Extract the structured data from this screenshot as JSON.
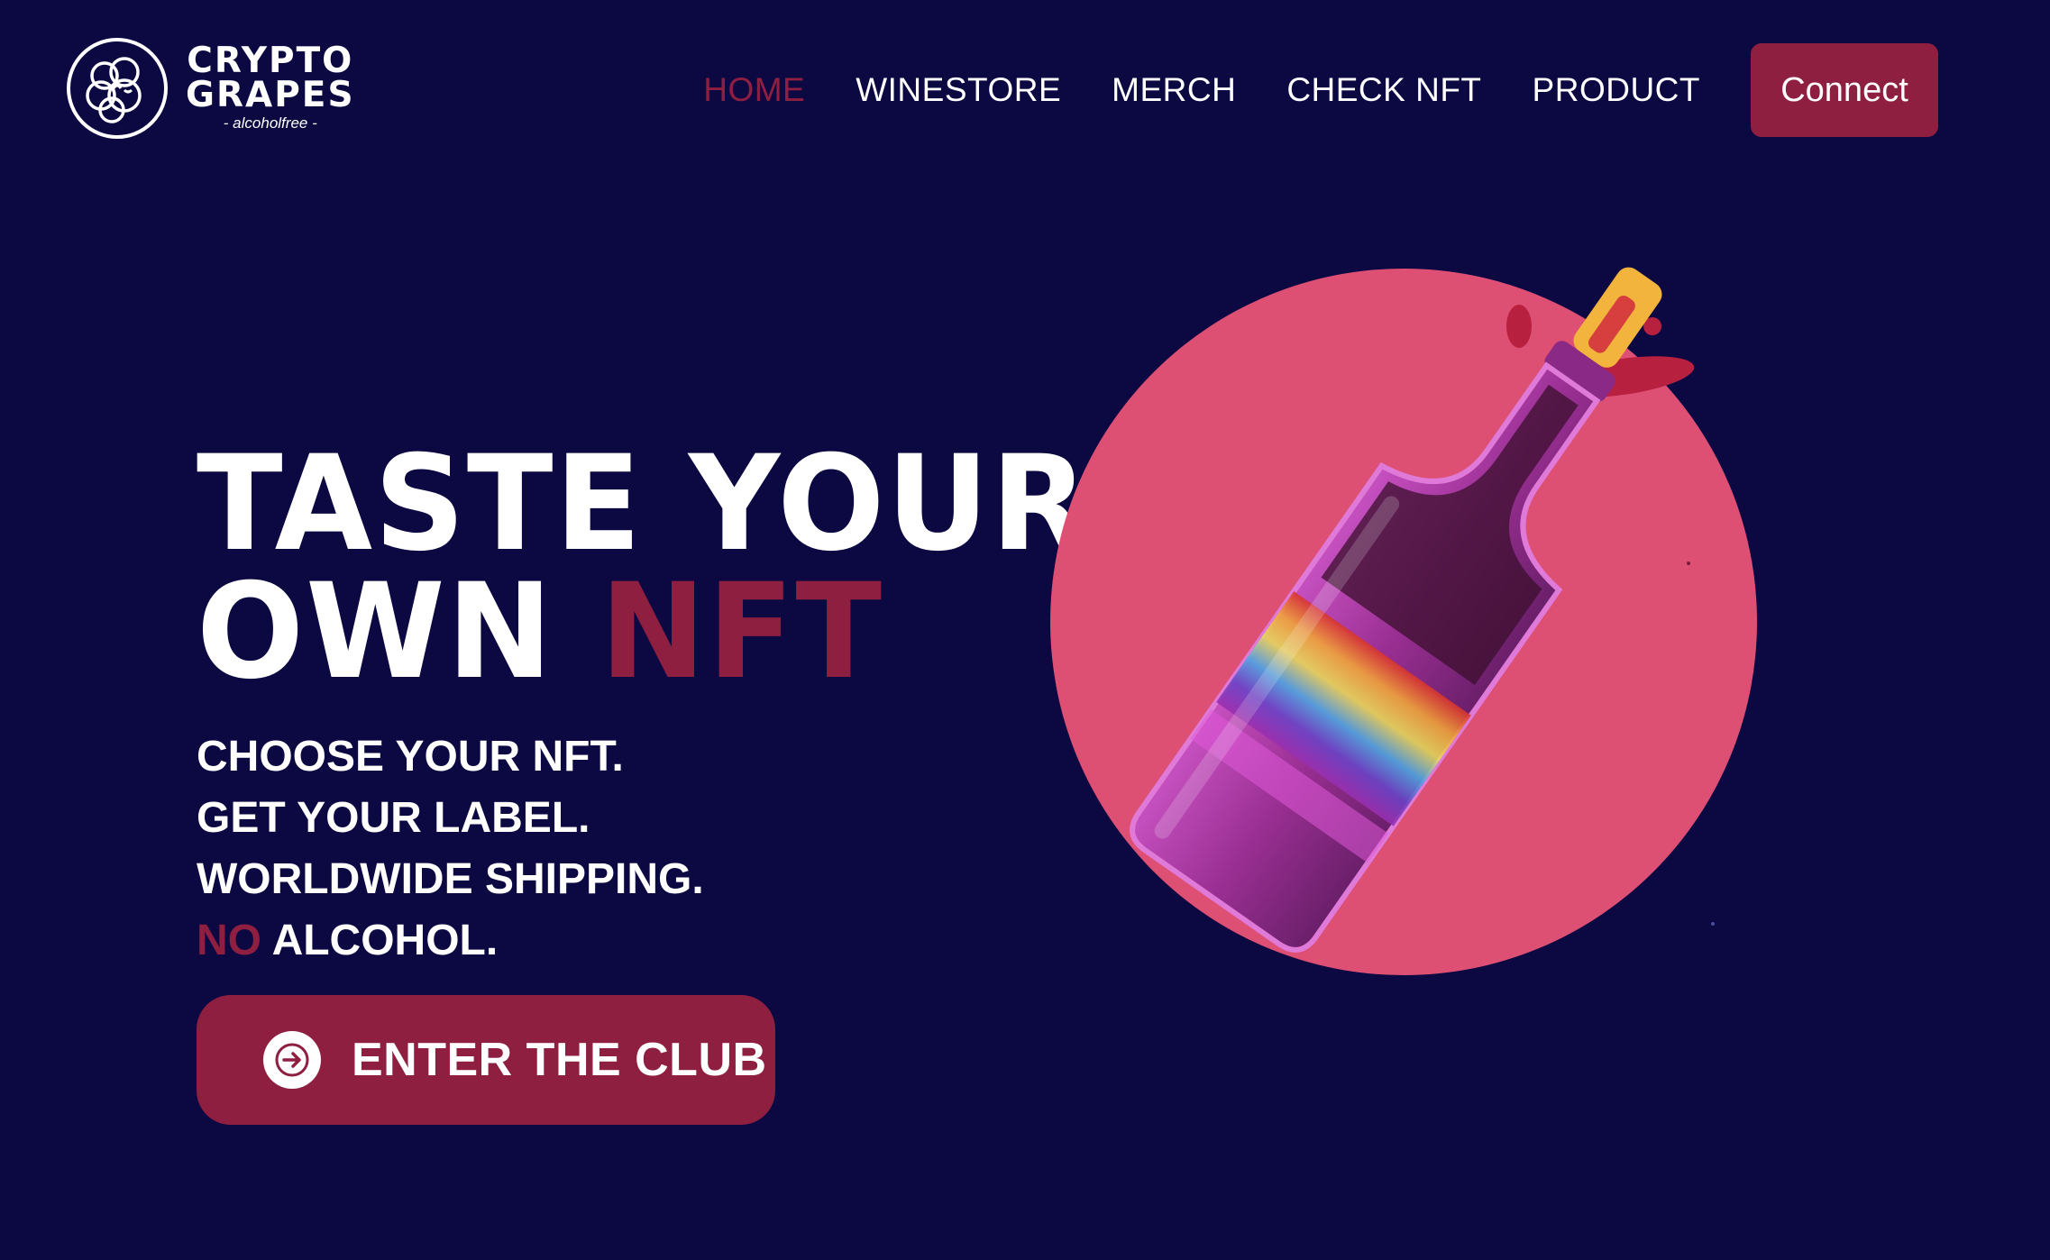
{
  "brand": {
    "line1": "CRYPTO",
    "line2": "GRAPES",
    "tagline": "- alcoholfree -",
    "logo_icon": "grape-face-icon"
  },
  "nav": {
    "items": [
      {
        "label": "HOME",
        "active": true
      },
      {
        "label": "WINESTORE",
        "active": false
      },
      {
        "label": "MERCH",
        "active": false
      },
      {
        "label": "CHECK NFT",
        "active": false
      },
      {
        "label": "PRODUCT",
        "active": false
      }
    ],
    "connect_label": "Connect"
  },
  "hero": {
    "title_line1": "TASTE YOUR",
    "title_line2_prefix": "OWN",
    "title_line2_accent": "NFT",
    "features": [
      "CHOOSE YOUR NFT.",
      "GET YOUR LABEL.",
      "WORLDWIDE SHIPPING."
    ],
    "feature_last_accent": "NO",
    "feature_last_rest": "ALCOHOL.",
    "cta_label": "ENTER THE CLUB",
    "cta_icon": "arrow-right-circle-icon"
  },
  "artwork": {
    "description_icon": "wine-bottle-illustration",
    "circle_color": "#de4f74",
    "bottle_color": "#9a2f93"
  },
  "colors": {
    "background": "#0b0842",
    "accent": "#8e1f40",
    "text": "#ffffff"
  }
}
